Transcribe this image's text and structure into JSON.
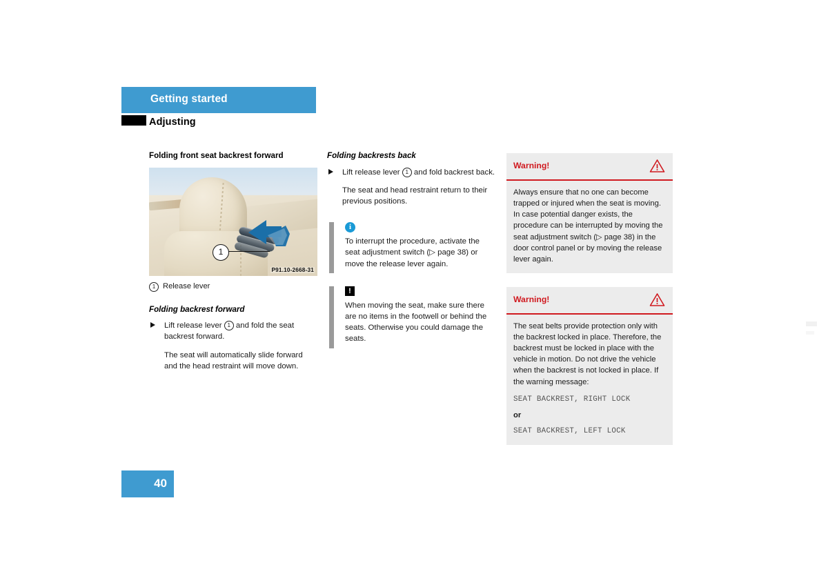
{
  "header": {
    "chapter": "Getting started",
    "section": "Adjusting"
  },
  "left_column": {
    "heading": "Folding front seat backrest forward",
    "figure": {
      "callout_number": "1",
      "figure_id": "P91.10-2668-31",
      "alt": "seat-headrest-release-lever-illustration"
    },
    "figure_caption": {
      "marker": "1",
      "text": "Release lever"
    },
    "subheading": "Folding backrest forward",
    "step": {
      "text_before": "Lift release lever",
      "marker": "1",
      "text_after": "and fold the seat backrest forward."
    },
    "result": "The seat will automatically slide forward and the head restraint will move down."
  },
  "middle_column": {
    "heading": "Folding backrests back",
    "step": {
      "text_before": "Lift release lever",
      "marker": "1",
      "text_after": "and fold backrest back."
    },
    "result": "The seat and head restraint return to their previous positions.",
    "notes": [
      {
        "icon": "info-icon",
        "icon_glyph": "i",
        "text": "To interrupt the procedure, activate the seat adjustment switch (▷ page 38) or move the release lever again."
      },
      {
        "icon": "caution-icon",
        "icon_glyph": "!",
        "text": "When moving the seat, make sure there are no items in the footwell or behind the seats. Otherwise you could damage the seats."
      }
    ]
  },
  "right_column": {
    "warnings": [
      {
        "title": "Warning!",
        "icon": "warning-triangle-icon",
        "body": "Always ensure that no one can become trapped or injured when the seat is moving. In case potential danger exists, the procedure can be interrupted by moving the seat adjustment switch (▷ page 38) in the door control panel or by moving the release lever again."
      },
      {
        "title": "Warning!",
        "icon": "warning-triangle-icon",
        "body": "The seat belts provide protection only with the backrest locked in place. Therefore, the backrest must be locked in place with the vehicle in motion. Do not drive the vehicle when the backrest is not locked in place. If the warning message:",
        "message_1": "SEAT BACKREST, RIGHT LOCK",
        "conjunction": "or",
        "message_2": "SEAT BACKREST, LEFT LOCK"
      }
    ]
  },
  "footer": {
    "page_number": "40"
  },
  "colors": {
    "accent_blue": "#3f9bd0",
    "warning_red": "#d0191f",
    "note_gray": "#9a9a9a",
    "warning_bg": "#ececec",
    "info_blue": "#1a9ad6"
  }
}
